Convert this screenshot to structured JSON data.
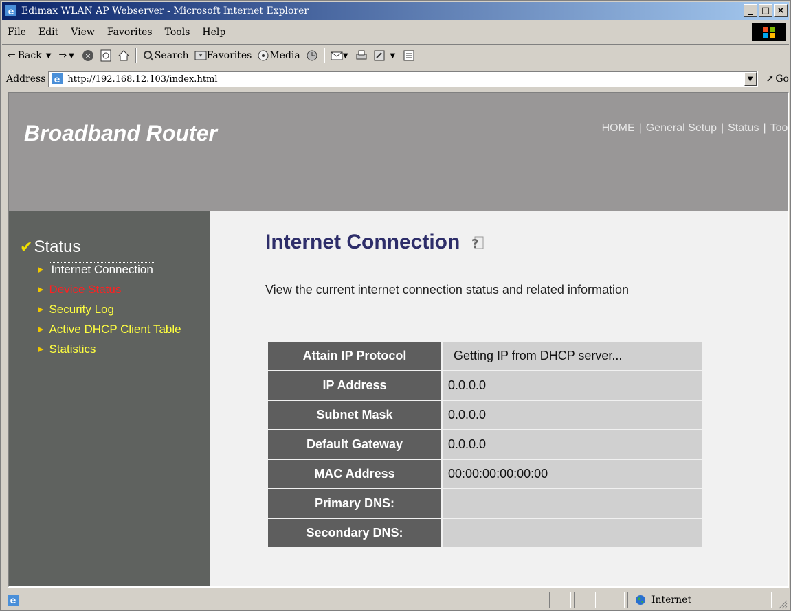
{
  "window": {
    "title": "Edimax WLAN AP Webserver - Microsoft Internet Explorer",
    "buttons": {
      "minimize": "_",
      "maximize": "□",
      "close": "×"
    }
  },
  "menubar": {
    "items": [
      "File",
      "Edit",
      "View",
      "Favorites",
      "Tools",
      "Help"
    ]
  },
  "toolbar": {
    "back": "Back",
    "search": "Search",
    "favorites": "Favorites",
    "media": "Media"
  },
  "address": {
    "label": "Address",
    "url": "http://192.168.12.103/index.html",
    "go": "Go"
  },
  "page": {
    "brand": "Broadband Router",
    "topnav": [
      "HOME",
      "General Setup",
      "Status",
      "Tool"
    ],
    "sidebar": {
      "title": "Status",
      "items": [
        {
          "label": "Internet Connection",
          "state": "selected"
        },
        {
          "label": "Device Status",
          "state": "hover"
        },
        {
          "label": "Security Log",
          "state": "normal"
        },
        {
          "label": "Active DHCP Client Table",
          "state": "normal"
        },
        {
          "label": "Statistics",
          "state": "normal"
        }
      ]
    },
    "heading": "Internet Connection",
    "description": "View the current internet connection status and related information",
    "table": [
      {
        "key": "Attain IP Protocol",
        "value": "Getting IP from DHCP server..."
      },
      {
        "key": "IP Address",
        "value": "0.0.0.0"
      },
      {
        "key": "Subnet Mask",
        "value": "0.0.0.0"
      },
      {
        "key": "Default Gateway",
        "value": "0.0.0.0"
      },
      {
        "key": "MAC Address",
        "value": "00:00:00:00:00:00"
      },
      {
        "key": "Primary DNS:",
        "value": ""
      },
      {
        "key": "Secondary DNS:",
        "value": ""
      }
    ]
  },
  "statusbar": {
    "zone": "Internet"
  },
  "colors": {
    "header_bg": "#999797",
    "sidebar_bg": "#5f625f",
    "heading": "#2e2e6a",
    "key_cell": "#5e5e5e",
    "value_cell": "#d0d0d0",
    "link_yellow": "#ffff40",
    "link_red": "#ff2020"
  }
}
